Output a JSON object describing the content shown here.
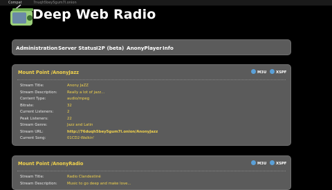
{
  "topbar": {
    "compat_label": "Compat",
    "onion_text": "7nuqh5bey5gum7l.onion"
  },
  "header": {
    "title": "Deep Web Radio",
    "logo_icon": "radio-logo-icon"
  },
  "nav": [
    "Administration",
    "Server Status",
    "I2P (beta)",
    "AnonyPlayer",
    "Info"
  ],
  "mounts": [
    {
      "mount_label": "Mount Point /AnonyJazz",
      "m3u": "M3U",
      "xspf": "XSPF",
      "fields": [
        {
          "key": "Stream Title:",
          "value": "Anony JaZZ"
        },
        {
          "key": "Stream Description:",
          "value": "Really a lot of jazz..."
        },
        {
          "key": "Content Type:",
          "value": "audio/mpeg"
        },
        {
          "key": "Bitrate:",
          "value": "32"
        },
        {
          "key": "Current Listeners:",
          "value": "2"
        },
        {
          "key": "Peak Listeners:",
          "value": "22"
        },
        {
          "key": "Stream Genre:",
          "value": "Jazz and Latin"
        },
        {
          "key": "Stream URL:",
          "value": "http://76duqh5bey5gum7l.onion/AnonyJazz"
        },
        {
          "key": "Current Song:",
          "value": "01CD2-Walkin'"
        }
      ]
    },
    {
      "mount_label": "Mount Point /AnonyRadio",
      "m3u": "M3U",
      "xspf": "XSPF",
      "fields": [
        {
          "key": "Stream Title:",
          "value": "Radio Clandestiné"
        },
        {
          "key": "Stream Description:",
          "value": "Music to go deep and make love..."
        }
      ]
    }
  ]
}
